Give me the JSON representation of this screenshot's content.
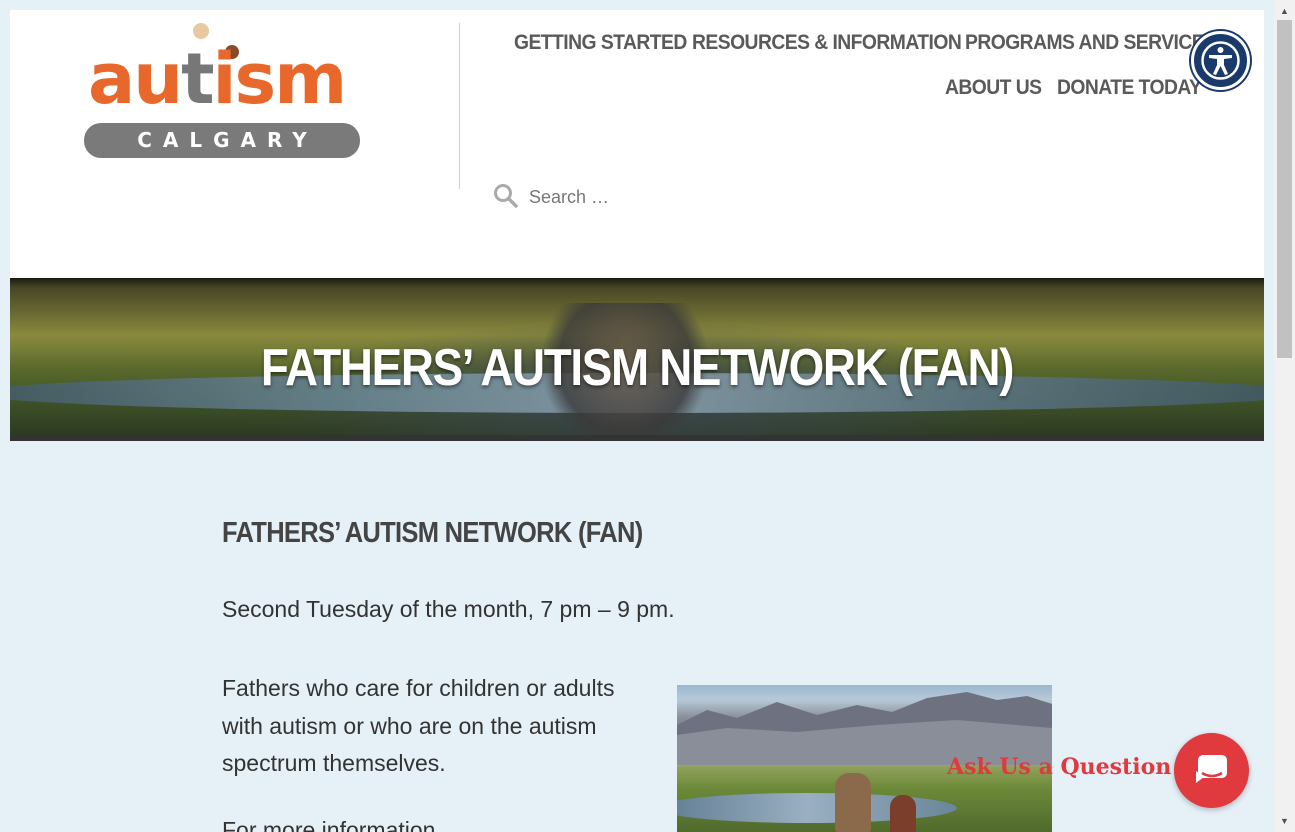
{
  "site": {
    "logo_text": "autism",
    "logo_subtext": "CALGARY"
  },
  "nav": {
    "items": [
      {
        "label": "GETTING STARTED"
      },
      {
        "label": "RESOURCES & INFORMATION"
      },
      {
        "label": "PROGRAMS AND SERVICES"
      },
      {
        "label": "ABOUT US"
      },
      {
        "label": "DONATE TODAY"
      }
    ]
  },
  "search": {
    "placeholder": "Search …",
    "icon": "search-icon"
  },
  "accessibility": {
    "icon": "accessibility-icon",
    "color": "#1a3a6b"
  },
  "hero": {
    "title": "FATHERS’ AUTISM NETWORK (FAN)"
  },
  "content": {
    "heading": "FATHERS’ AUTISM NETWORK (FAN)",
    "schedule": "Second Tuesday of the month, 7 pm – 9 pm.",
    "description": "Fathers who care for children or adults with autism or who are on the autism spectrum themselves.",
    "more_info": "For more information"
  },
  "chat": {
    "label": "Ask Us a Question",
    "icon": "chat-bubble-icon",
    "color": "#e0393e"
  },
  "colors": {
    "brand_orange": "#e8672a",
    "brand_gray": "#7a7a7a",
    "page_background": "#e6f0f7"
  }
}
